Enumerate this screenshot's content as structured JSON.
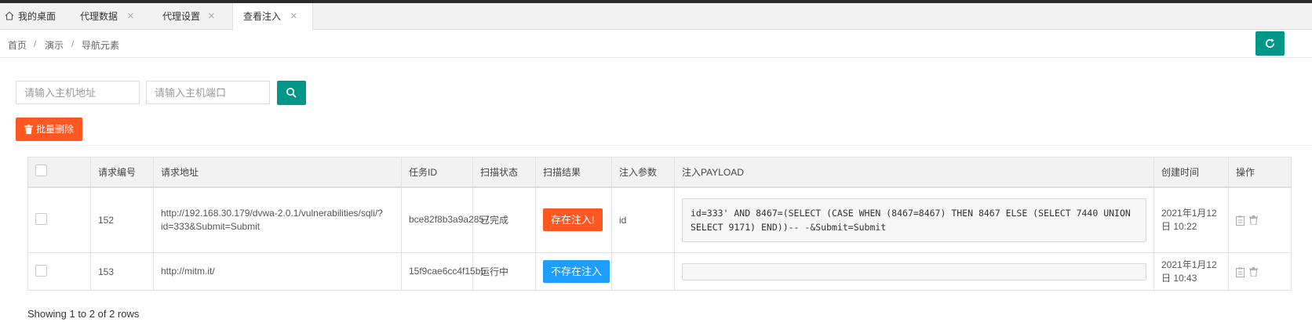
{
  "tabs": [
    {
      "label": "我的桌面",
      "closable": false,
      "active": false
    },
    {
      "label": "代理数据",
      "closable": true,
      "active": false
    },
    {
      "label": "代理设置",
      "closable": true,
      "active": false
    },
    {
      "label": "查看注入",
      "closable": true,
      "active": true
    }
  ],
  "breadcrumb": [
    "首页",
    "演示",
    "导航元素"
  ],
  "search": {
    "host_placeholder": "请输入主机地址",
    "port_placeholder": "请输入主机端口"
  },
  "toolbar": {
    "batch_delete_label": "批量删除"
  },
  "table": {
    "columns": [
      "请求编号",
      "请求地址",
      "任务ID",
      "扫描状态",
      "扫描结果",
      "注入参数",
      "注入PAYLOAD",
      "创建时间",
      "操作"
    ],
    "rows": [
      {
        "id": "152",
        "url": "http://192.168.30.179/dvwa-2.0.1/vulnerabilities/sqli/?id=333&Submit=Submit",
        "task_id": "bce82f8b3a9a2857",
        "scan_status": "已完成",
        "scan_result": "存在注入!",
        "scan_result_type": "danger",
        "param": "id",
        "payload": "id=333' AND 8467=(SELECT (CASE WHEN (8467=8467) THEN 8467 ELSE (SELECT 7440 UNION SELECT 9171) END))-- -&Submit=Submit",
        "created": "2021年1月12日 10:22"
      },
      {
        "id": "153",
        "url": "http://mitm.it/",
        "task_id": "15f9cae6cc4f15b5",
        "scan_status": "运行中",
        "scan_result": "不存在注入",
        "scan_result_type": "info",
        "param": "",
        "payload": "",
        "created": "2021年1月12日 10:43"
      }
    ]
  },
  "footer": {
    "pagination_info": "Showing 1 to 2 of 2 rows"
  },
  "colors": {
    "primary": "#009688",
    "danger": "#ff5722",
    "info": "#1e9fff"
  }
}
